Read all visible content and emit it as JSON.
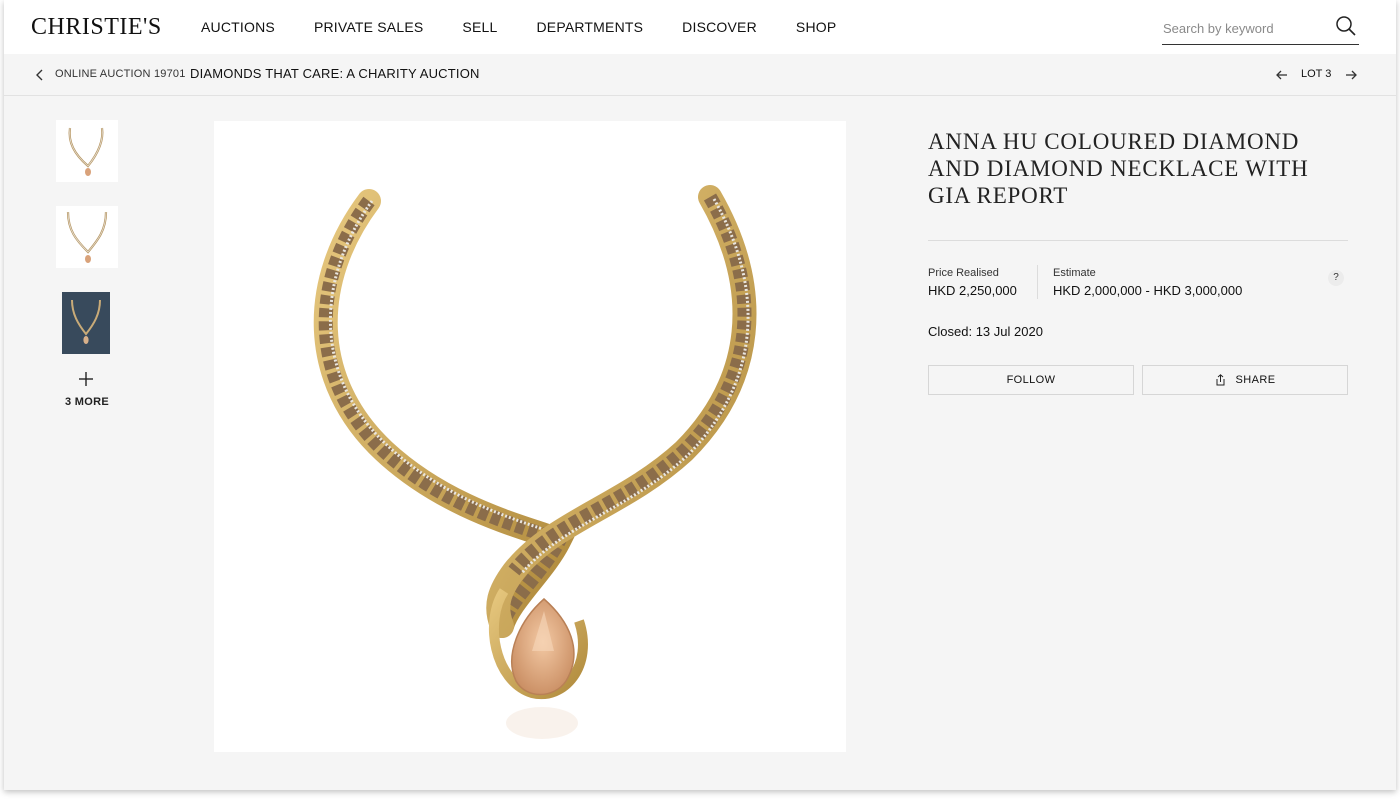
{
  "header": {
    "logo": "CHRISTIE'S",
    "nav": [
      "AUCTIONS",
      "PRIVATE SALES",
      "SELL",
      "DEPARTMENTS",
      "DISCOVER",
      "SHOP"
    ],
    "search": {
      "placeholder": "Search by keyword",
      "icon": "search-icon"
    }
  },
  "breadcrumb": {
    "auction": "ONLINE AUCTION 19701",
    "title": "DIAMONDS THAT CARE: A CHARITY AUCTION",
    "lot": "LOT 3"
  },
  "gallery": {
    "more_label": "3 MORE"
  },
  "lot": {
    "title": "ANNA HU COLOURED DIAMOND AND DIAMOND NECKLACE WITH GIA REPORT",
    "price_label": "Price Realised",
    "price_value": "HKD 2,250,000",
    "estimate_label": "Estimate",
    "estimate_value": "HKD 2,000,000 - HKD 3,000,000",
    "help": "?",
    "closed_label": "Closed:",
    "closed_date": "13 Jul 2020",
    "follow_label": "FOLLOW",
    "share_label": "SHARE"
  },
  "colors": {
    "page_bg": "#f5f5f5",
    "header_bg": "#ffffff",
    "text": "#111111",
    "gold": "#c9a24e",
    "thumb_dark": "#384a5c"
  }
}
